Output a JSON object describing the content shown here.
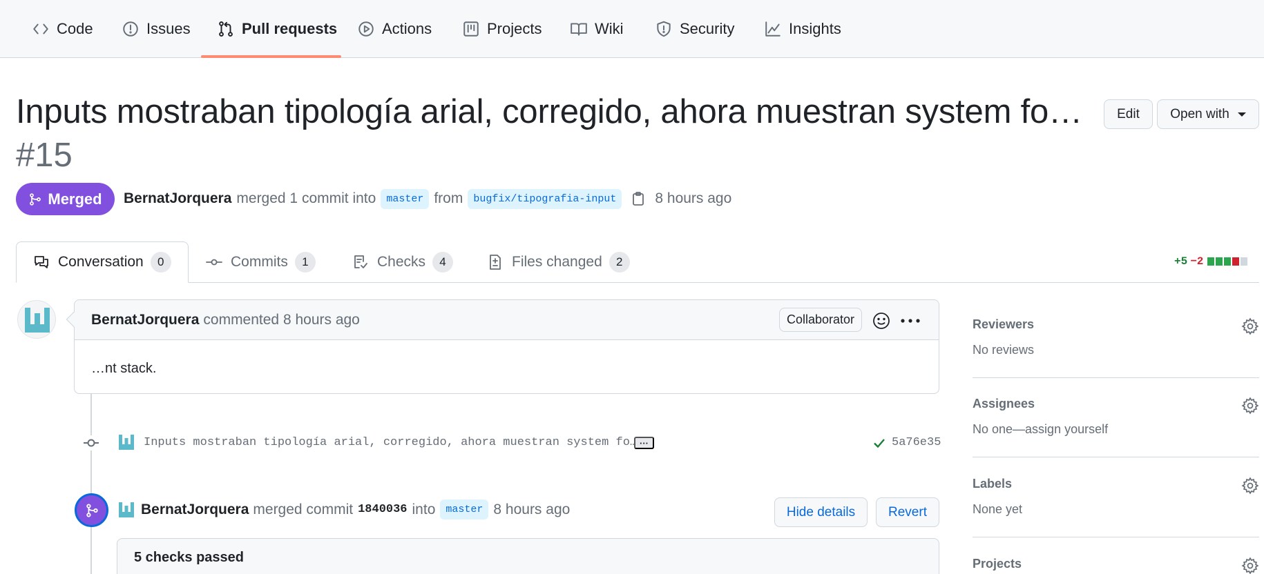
{
  "repo_nav": {
    "tabs": [
      {
        "label": "Code",
        "icon": "code-icon"
      },
      {
        "label": "Issues",
        "icon": "issue-icon"
      },
      {
        "label": "Pull requests",
        "icon": "pull-request-icon",
        "active": true
      },
      {
        "label": "Actions",
        "icon": "play-icon"
      },
      {
        "label": "Projects",
        "icon": "project-board-icon"
      },
      {
        "label": "Wiki",
        "icon": "book-icon"
      },
      {
        "label": "Security",
        "icon": "shield-icon"
      },
      {
        "label": "Insights",
        "icon": "graph-icon"
      }
    ]
  },
  "pr": {
    "title": "Inputs mostraban tipología arial, corregido, ahora muestran system fo…",
    "number": "#15",
    "edit_label": "Edit",
    "open_with_label": "Open with",
    "state": "Merged",
    "author": "BernatJorquera",
    "merge_text": "merged 1 commit into",
    "base_branch": "master",
    "from_text": "from",
    "head_branch": "bugfix/tipografia-input",
    "time": "8 hours ago"
  },
  "pr_tabs": [
    {
      "label": "Conversation",
      "count": "0",
      "icon": "conversation-icon"
    },
    {
      "label": "Commits",
      "count": "1",
      "icon": "commit-icon"
    },
    {
      "label": "Checks",
      "count": "4",
      "icon": "checklist-icon"
    },
    {
      "label": "Files changed",
      "count": "2",
      "icon": "file-diff-icon"
    }
  ],
  "diffstat": {
    "additions": "+5",
    "deletions": "−2",
    "blocks": [
      "add",
      "add",
      "add",
      "del",
      "neutral"
    ]
  },
  "comment": {
    "author": "BernatJorquera",
    "action": "commented 8 hours ago",
    "role": "Collaborator",
    "body": "…nt stack."
  },
  "commit_item": {
    "message": "Inputs mostraban tipología arial, corregido, ahora muestran system fo…",
    "ellipsis": "···",
    "sha": "5a76e35"
  },
  "merge_event": {
    "author": "BernatJorquera",
    "action": "merged commit",
    "sha": "1840036",
    "into": "into",
    "branch": "master",
    "time": "8 hours ago",
    "hide_details_label": "Hide details",
    "revert_label": "Revert",
    "checks_summary": "5 checks passed"
  },
  "sidebar": {
    "reviewers": {
      "title": "Reviewers",
      "value": "No reviews"
    },
    "assignees": {
      "title": "Assignees",
      "value": "No one—assign yourself"
    },
    "labels": {
      "title": "Labels",
      "value": "None yet"
    },
    "projects": {
      "title": "Projects"
    }
  },
  "colors": {
    "merged": "#8250df",
    "accent": "#0969da",
    "underline": "#fd8c73",
    "success": "#1a7f37",
    "danger": "#cf222e"
  }
}
